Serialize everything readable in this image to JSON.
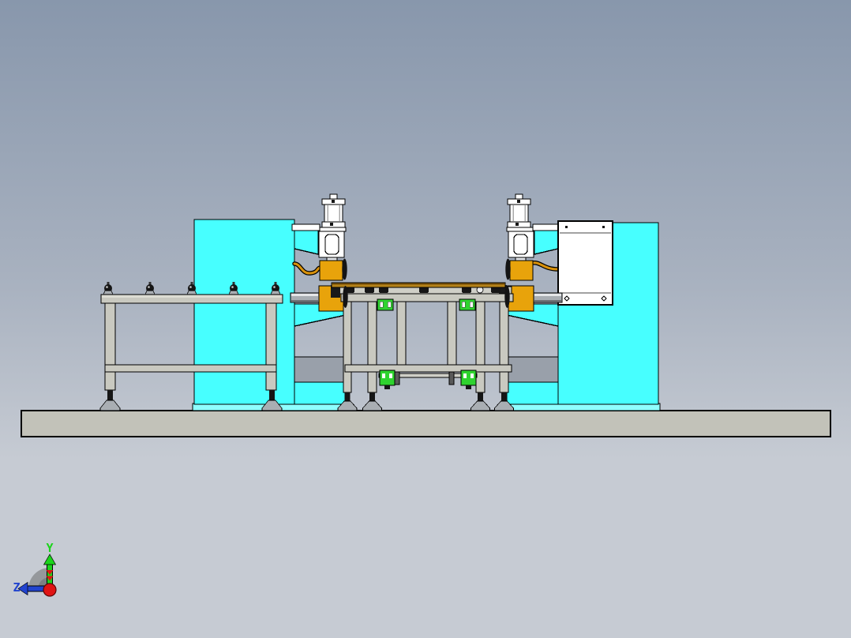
{
  "viewport": {
    "axis_labels": {
      "y": "Y",
      "z": "Z"
    }
  },
  "colors": {
    "bg_top": "#8897AC",
    "bg_mid": "#A9B2C0",
    "bg_bottom": "#C6CBD3",
    "machine_cyan": "#47FFFF",
    "machine_cyan_light": "#8FFFFF",
    "frame_gray": "#C9C9C0",
    "frame_gray_light": "#DDDDD4",
    "base_gray": "#C2C2B9",
    "recess_gray": "#99A0AA",
    "panel_white": "#FFFFFF",
    "electrode_orange": "#E8A30B",
    "cable_orange": "#D9920B",
    "clamp_green": "#2FD32F",
    "strip_tan": "#B5831A",
    "steel_light": "#E4E6E8",
    "steel_mid": "#A9AEB3",
    "steel_dark": "#6E7276",
    "part_black": "#161616",
    "outline": "#000000",
    "axis_green": "#1BD41B",
    "axis_blue": "#2143CE",
    "axis_red": "#E01414",
    "triad_gray": "#8F9296",
    "triad_gray_dark": "#7A7D82"
  }
}
